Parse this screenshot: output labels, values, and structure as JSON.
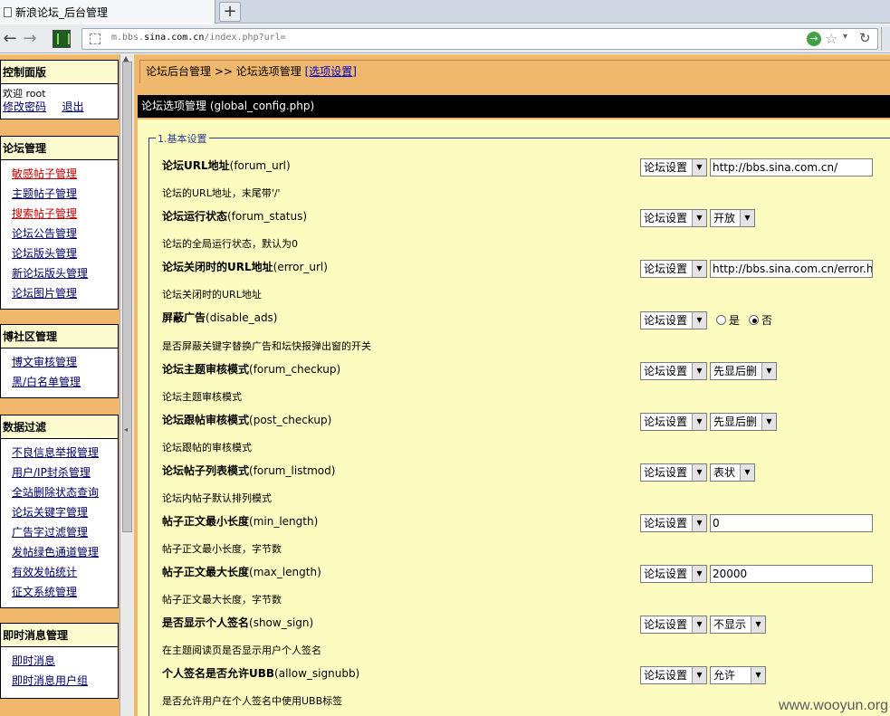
{
  "browser": {
    "tab_title": "新浪论坛_后台管理",
    "new_tab": "+",
    "url_prefix": "m.bbs.",
    "url_host": "sina.com.cn",
    "url_path": "/index.php?url="
  },
  "sidebar": {
    "control": {
      "title": "控制面版",
      "welcome": "欢迎 root",
      "change_password": "修改密码",
      "logout": "退出"
    },
    "forum": {
      "title": "论坛管理",
      "items": [
        "敏感帖子管理",
        "主题帖子管理",
        "搜索帖子管理",
        "论坛公告管理",
        "论坛版头管理",
        "新论坛版头管理",
        "论坛图片管理"
      ]
    },
    "blog": {
      "title": "博社区管理",
      "items": [
        "博文审核管理",
        "黑/白名单管理"
      ]
    },
    "filter": {
      "title": "数据过滤",
      "items": [
        "不良信息举报管理",
        "用户/IP封杀管理",
        "全站删除状态查询",
        "论坛关键字管理",
        "广告字过滤管理",
        "发帖绿色通道管理",
        "有效发帖统计",
        "征文系统管理"
      ]
    },
    "im": {
      "title": "即时消息管理",
      "items": [
        "即时消息",
        "即时消息用户组"
      ]
    }
  },
  "main": {
    "breadcrumb": {
      "home": "论坛后台管理",
      "sep": ">>",
      "current": "论坛选项管理",
      "link": "[选项设置]"
    },
    "header": "论坛选项管理 (global_config.php)",
    "section": "1.基本设置",
    "scope_label": "论坛设置",
    "rows": [
      {
        "title": "论坛URL地址",
        "key": "(forum_url)",
        "desc": "论坛的URL地址，末尾带'/'",
        "value": "http://bbs.sina.com.cn/"
      },
      {
        "title": "论坛运行状态",
        "key": "(forum_status)",
        "desc": "论坛的全局运行状态，默认为0",
        "value": "开放"
      },
      {
        "title": "论坛关闭时的URL地址",
        "key": "(error_url)",
        "desc": "论坛关闭时的URL地址",
        "value": "http://bbs.sina.com.cn/error.html"
      },
      {
        "title": "屏蔽广告",
        "key": "(disable_ads)",
        "desc": "是否屏蔽关键字替换广告和坛快报弹出窗的开关",
        "radio_yes": "是",
        "radio_no": "否"
      },
      {
        "title": "论坛主题审核模式",
        "key": "(forum_checkup)",
        "desc": "论坛主题审核模式",
        "value": "先显后删"
      },
      {
        "title": "论坛跟帖审核模式",
        "key": "(post_checkup)",
        "desc": "论坛跟帖的审核模式",
        "value": "先显后删"
      },
      {
        "title": "论坛帖子列表模式",
        "key": "(forum_listmod)",
        "desc": "论坛内帖子默认排列模式",
        "value": "表状"
      },
      {
        "title": "帖子正文最小长度",
        "key": "(min_length)",
        "desc": "帖子正文最小长度，字节数",
        "value": "0"
      },
      {
        "title": "帖子正文最大长度",
        "key": "(max_length)",
        "desc": "帖子正文最大长度，字节数",
        "value": "20000"
      },
      {
        "title": "是否显示个人签名",
        "key": "(show_sign)",
        "desc": "在主题阅读页是否显示用户个人签名",
        "value": "不显示"
      },
      {
        "title": "个人签名是否允许UBB",
        "key": "(allow_signubb)",
        "desc": "是否允许用户在个人签名中使用UBB标签",
        "value": "允许"
      }
    ]
  },
  "watermark": "www.wooyun.org",
  "colors": {
    "frame_orange": "#f0b86c",
    "content_yellow": "#fcfcc0",
    "header_black": "#000000",
    "link_blue": "#000066",
    "link_red": "#c00000"
  }
}
